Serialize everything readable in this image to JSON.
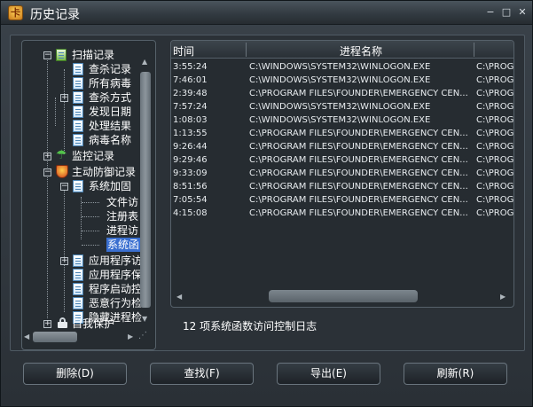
{
  "window": {
    "title": "历史记录"
  },
  "tree": {
    "items": [
      {
        "label": "扫描记录"
      },
      {
        "label": "查杀记录"
      },
      {
        "label": "所有病毒"
      },
      {
        "label": "查杀方式"
      },
      {
        "label": "发现日期"
      },
      {
        "label": "处理结果"
      },
      {
        "label": "病毒名称"
      },
      {
        "label": "监控记录"
      },
      {
        "label": "主动防御记录"
      },
      {
        "label": "系统加固"
      },
      {
        "label": "文件访"
      },
      {
        "label": "注册表"
      },
      {
        "label": "进程访"
      },
      {
        "label": "系统函"
      },
      {
        "label": "应用程序访"
      },
      {
        "label": "应用程序保"
      },
      {
        "label": "程序启动控"
      },
      {
        "label": "恶意行为检"
      },
      {
        "label": "隐藏进程检"
      },
      {
        "label": "自我保护"
      }
    ]
  },
  "table": {
    "headers": [
      "时间",
      "进程名称",
      ""
    ],
    "rows": [
      [
        "3:55:24",
        "C:\\WINDOWS\\SYSTEM32\\WINLOGON.EXE",
        "C:\\PROG"
      ],
      [
        "7:46:01",
        "C:\\WINDOWS\\SYSTEM32\\WINLOGON.EXE",
        "C:\\PROG"
      ],
      [
        "2:39:48",
        "C:\\PROGRAM FILES\\FOUNDER\\EMERGENCY CEN...",
        "C:\\PROG"
      ],
      [
        "7:57:24",
        "C:\\WINDOWS\\SYSTEM32\\WINLOGON.EXE",
        "C:\\PROG"
      ],
      [
        "1:08:03",
        "C:\\WINDOWS\\SYSTEM32\\WINLOGON.EXE",
        "C:\\PROG"
      ],
      [
        "1:13:55",
        "C:\\PROGRAM FILES\\FOUNDER\\EMERGENCY CEN...",
        "C:\\PROG"
      ],
      [
        "9:26:44",
        "C:\\PROGRAM FILES\\FOUNDER\\EMERGENCY CEN...",
        "C:\\PROG"
      ],
      [
        "9:29:46",
        "C:\\PROGRAM FILES\\FOUNDER\\EMERGENCY CEN...",
        "C:\\PROG"
      ],
      [
        "9:33:09",
        "C:\\PROGRAM FILES\\FOUNDER\\EMERGENCY CEN...",
        "C:\\PROG"
      ],
      [
        "8:51:56",
        "C:\\PROGRAM FILES\\FOUNDER\\EMERGENCY CEN...",
        "C:\\PROG"
      ],
      [
        "7:05:54",
        "C:\\PROGRAM FILES\\FOUNDER\\EMERGENCY CEN...",
        "C:\\PROG"
      ],
      [
        "4:15:08",
        "C:\\PROGRAM FILES\\FOUNDER\\EMERGENCY CEN...",
        "C:\\PROG"
      ]
    ]
  },
  "status": {
    "text": "12 项系统函数访问控制日志"
  },
  "buttons": {
    "delete": "删除(D)",
    "find": "查找(F)",
    "export": "导出(E)",
    "refresh": "刷新(R)"
  }
}
